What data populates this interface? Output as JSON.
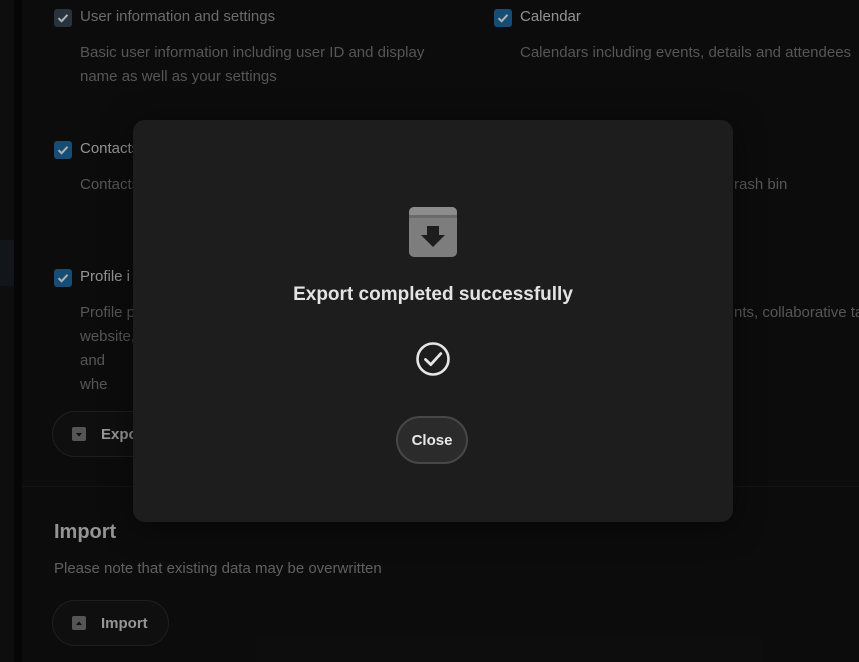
{
  "export_options": [
    {
      "label": "User information and settings",
      "description": [
        "Basic user information including user ID and display",
        "name as well as your settings"
      ]
    },
    {
      "label": "Calendar",
      "description": [
        "Calendars including events, details and attendees"
      ]
    },
    {
      "label": "Contacts",
      "description": [
        "Contacts"
      ]
    },
    {
      "label": "",
      "description": [
        "rash bin"
      ]
    },
    {
      "label": "Profile i",
      "description": [
        "Profile p",
        "website,",
        "and whe"
      ]
    },
    {
      "label": "",
      "description": [
        "nts, collaborative ta"
      ]
    }
  ],
  "export_button": {
    "label": "Expo"
  },
  "import_section": {
    "title": "Import",
    "description": "Please note that existing data may be overwritten",
    "button_label": "Import"
  },
  "modal": {
    "title": "Export completed successfully",
    "close_label": "Close",
    "icons": {
      "top": "archive-download-icon",
      "status": "check-circle-icon"
    }
  },
  "colors": {
    "checkbox": "#1f6fa8",
    "background": "#121212",
    "modal": "#1d1d1d"
  }
}
